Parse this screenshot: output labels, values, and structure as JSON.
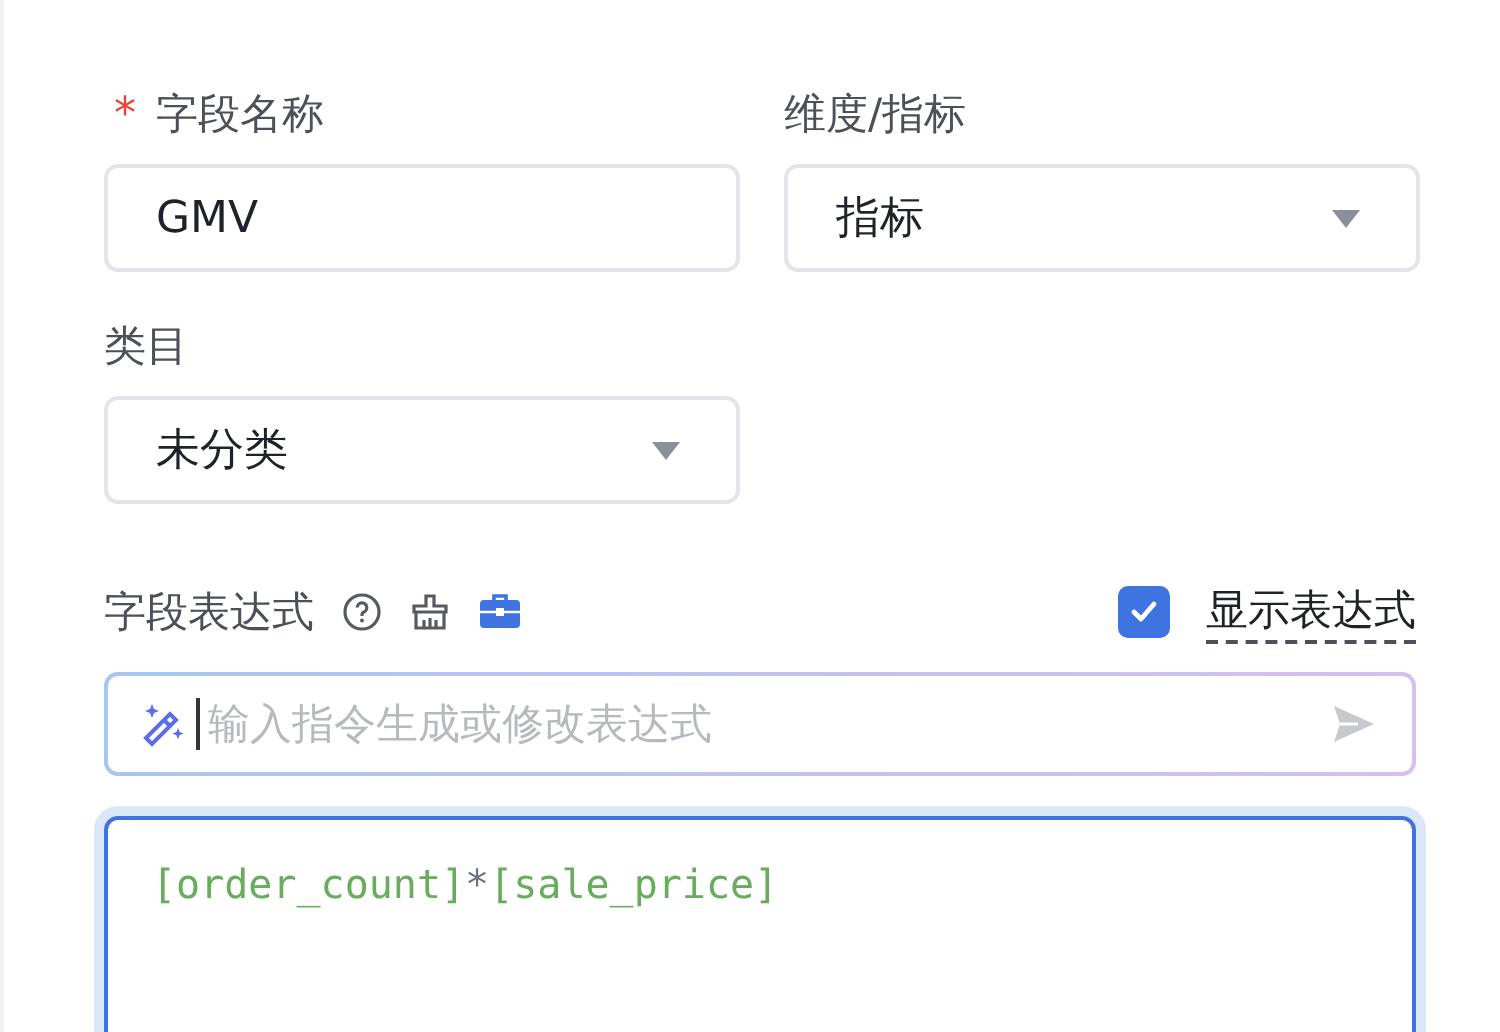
{
  "fields": [
    {
      "label": "字段名称",
      "required_mark": "*",
      "kind": "input",
      "value": "GMV"
    },
    {
      "label": "维度/指标",
      "kind": "select",
      "value": "指标"
    },
    {
      "label": "类目",
      "kind": "select",
      "value": "未分类"
    }
  ],
  "expression": {
    "label": "字段表达式",
    "show_expression": {
      "label": "显示表达式",
      "checked": true
    },
    "ai_input": {
      "placeholder": "输入指令生成或修改表达式"
    },
    "code": [
      {
        "kind": "field",
        "text": "[order_count]"
      },
      {
        "kind": "operator",
        "text": "*"
      },
      {
        "kind": "field",
        "text": "[sale_price]"
      }
    ]
  }
}
